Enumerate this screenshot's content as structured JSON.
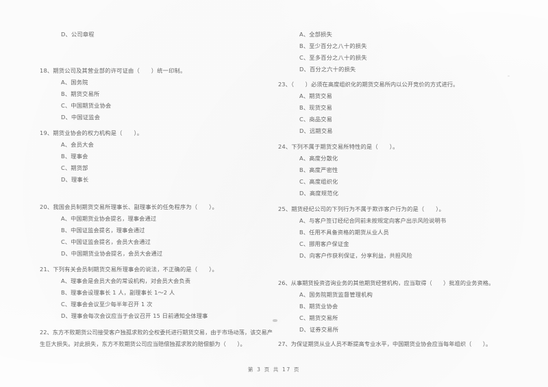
{
  "document": {
    "type": "scanned-exam-paper",
    "footer": "第 3 页 共 17 页"
  },
  "left_column": {
    "orphan_option": "D、公司章程",
    "questions": [
      {
        "number": "18",
        "stem": "18、期货公司及其营业部的许可证由（　　）统一印制。",
        "options": [
          "A、国务院",
          "B、期货交易所",
          "C、中国期货业协会",
          "D、中国证监会"
        ]
      },
      {
        "number": "19",
        "stem": "19、期货业协会的权力机构是（　　）。",
        "options": [
          "A、会员大会",
          "B、理事会",
          "C、期货部",
          "D、理事长"
        ]
      },
      {
        "number": "20",
        "stem": "20、我国会员制期货交易所理事长、副理事长的任免程序为（　　）。",
        "options": [
          "A、中国期货业协会提名，理事会通过",
          "B、中国证监会提名，理事会通过",
          "C、中国证监会提名，会员大会通过",
          "D、中国期货业协会提名，会员大会通过"
        ]
      },
      {
        "number": "21",
        "stem": "21、下列有关会员制期货交易所理事会的说法，不正确的是（　　）。",
        "options": [
          "A、理事会是会员大会的常设机构，对会员大会负责",
          "B、理事会设理事长 1 人，副理事长 1～2 人",
          "C、理事会会议至少每半年召开 1 次",
          "D、理事会每次会议应当于会议召开 15 日前通知全体理事"
        ]
      },
      {
        "number": "22",
        "stem_line1": "22、东方不败期货公司接受客户独孤求败的全权委托进行期货交易，由于市场动荡，该交易产",
        "stem_line2": "生巨大损失。对此损失，东方不败期货公司应当赔偿独孤求败的赔偿额为（　　）。",
        "options": []
      }
    ]
  },
  "right_column": {
    "orphan_options": [
      "A、全部损失",
      "B、至少百分之八十的损失",
      "C、至多百分之八十的损失",
      "D、百分之六十的损失"
    ],
    "questions": [
      {
        "number": "23",
        "stem": "23、（　　）必须在高度组织化的期货交易所内以公开竞价的方式进行。",
        "options": [
          "A、期货交易",
          "B、现货交易",
          "C、商品交易",
          "D、远期交易"
        ]
      },
      {
        "number": "24",
        "stem": "24、下列不属于期货交易所特性的是（　　）。",
        "options": [
          "A、高度分散化",
          "B、高度严密性",
          "C、高度组织化",
          "D、高度规范化"
        ]
      },
      {
        "number": "25",
        "stem": "25、期货经纪公司的下列行为不属于欺诈客户行为的是（　　）。",
        "options": [
          "A、与客户签订经纪合同前未按规定向客户出示风险说明书",
          "B、任用不具备资格的期货从业人员",
          "C、挪用客户保证金",
          "D、向客户作获利保证，分享利益，共担风险"
        ]
      },
      {
        "number": "26",
        "stem": "26、从事期货投资咨询业务的其他期货经营机构，应当取得（　　）批准的业务资格。",
        "options": [
          "A、国务院期货监督管理机构",
          "B、期货业协会",
          "C、期货交易所",
          "D、证券交易所"
        ]
      },
      {
        "number": "27",
        "stem": "27、为保证期货从业人员不断提高专业水平，中国期货业协会应当每年组织（　　）。",
        "options": []
      }
    ]
  }
}
